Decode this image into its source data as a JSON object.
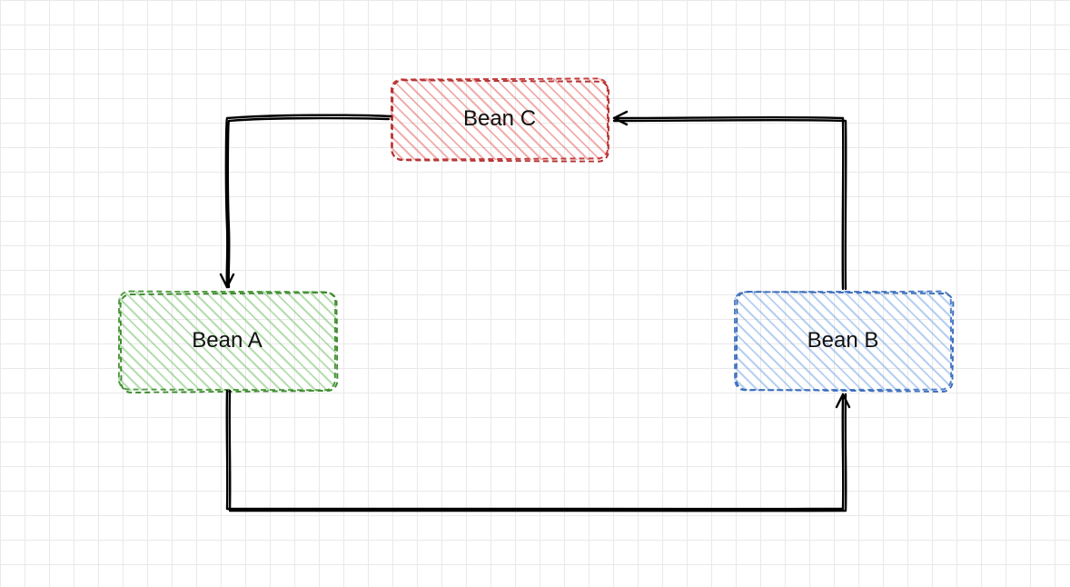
{
  "diagram": {
    "nodes": {
      "beanC": {
        "label": "Bean C",
        "color": "red",
        "hex": "#c43d3d"
      },
      "beanA": {
        "label": "Bean A",
        "color": "green",
        "hex": "#4f9b3f"
      },
      "beanB": {
        "label": "Bean B",
        "color": "blue",
        "hex": "#4f7ec7"
      }
    },
    "edges": [
      {
        "from": "beanC",
        "to": "beanA",
        "label": ""
      },
      {
        "from": "beanA",
        "to": "beanB",
        "label": ""
      },
      {
        "from": "beanB",
        "to": "beanC",
        "label": ""
      }
    ],
    "style": "sketchy-hatched",
    "cycle": [
      "beanC",
      "beanA",
      "beanB",
      "beanC"
    ]
  }
}
